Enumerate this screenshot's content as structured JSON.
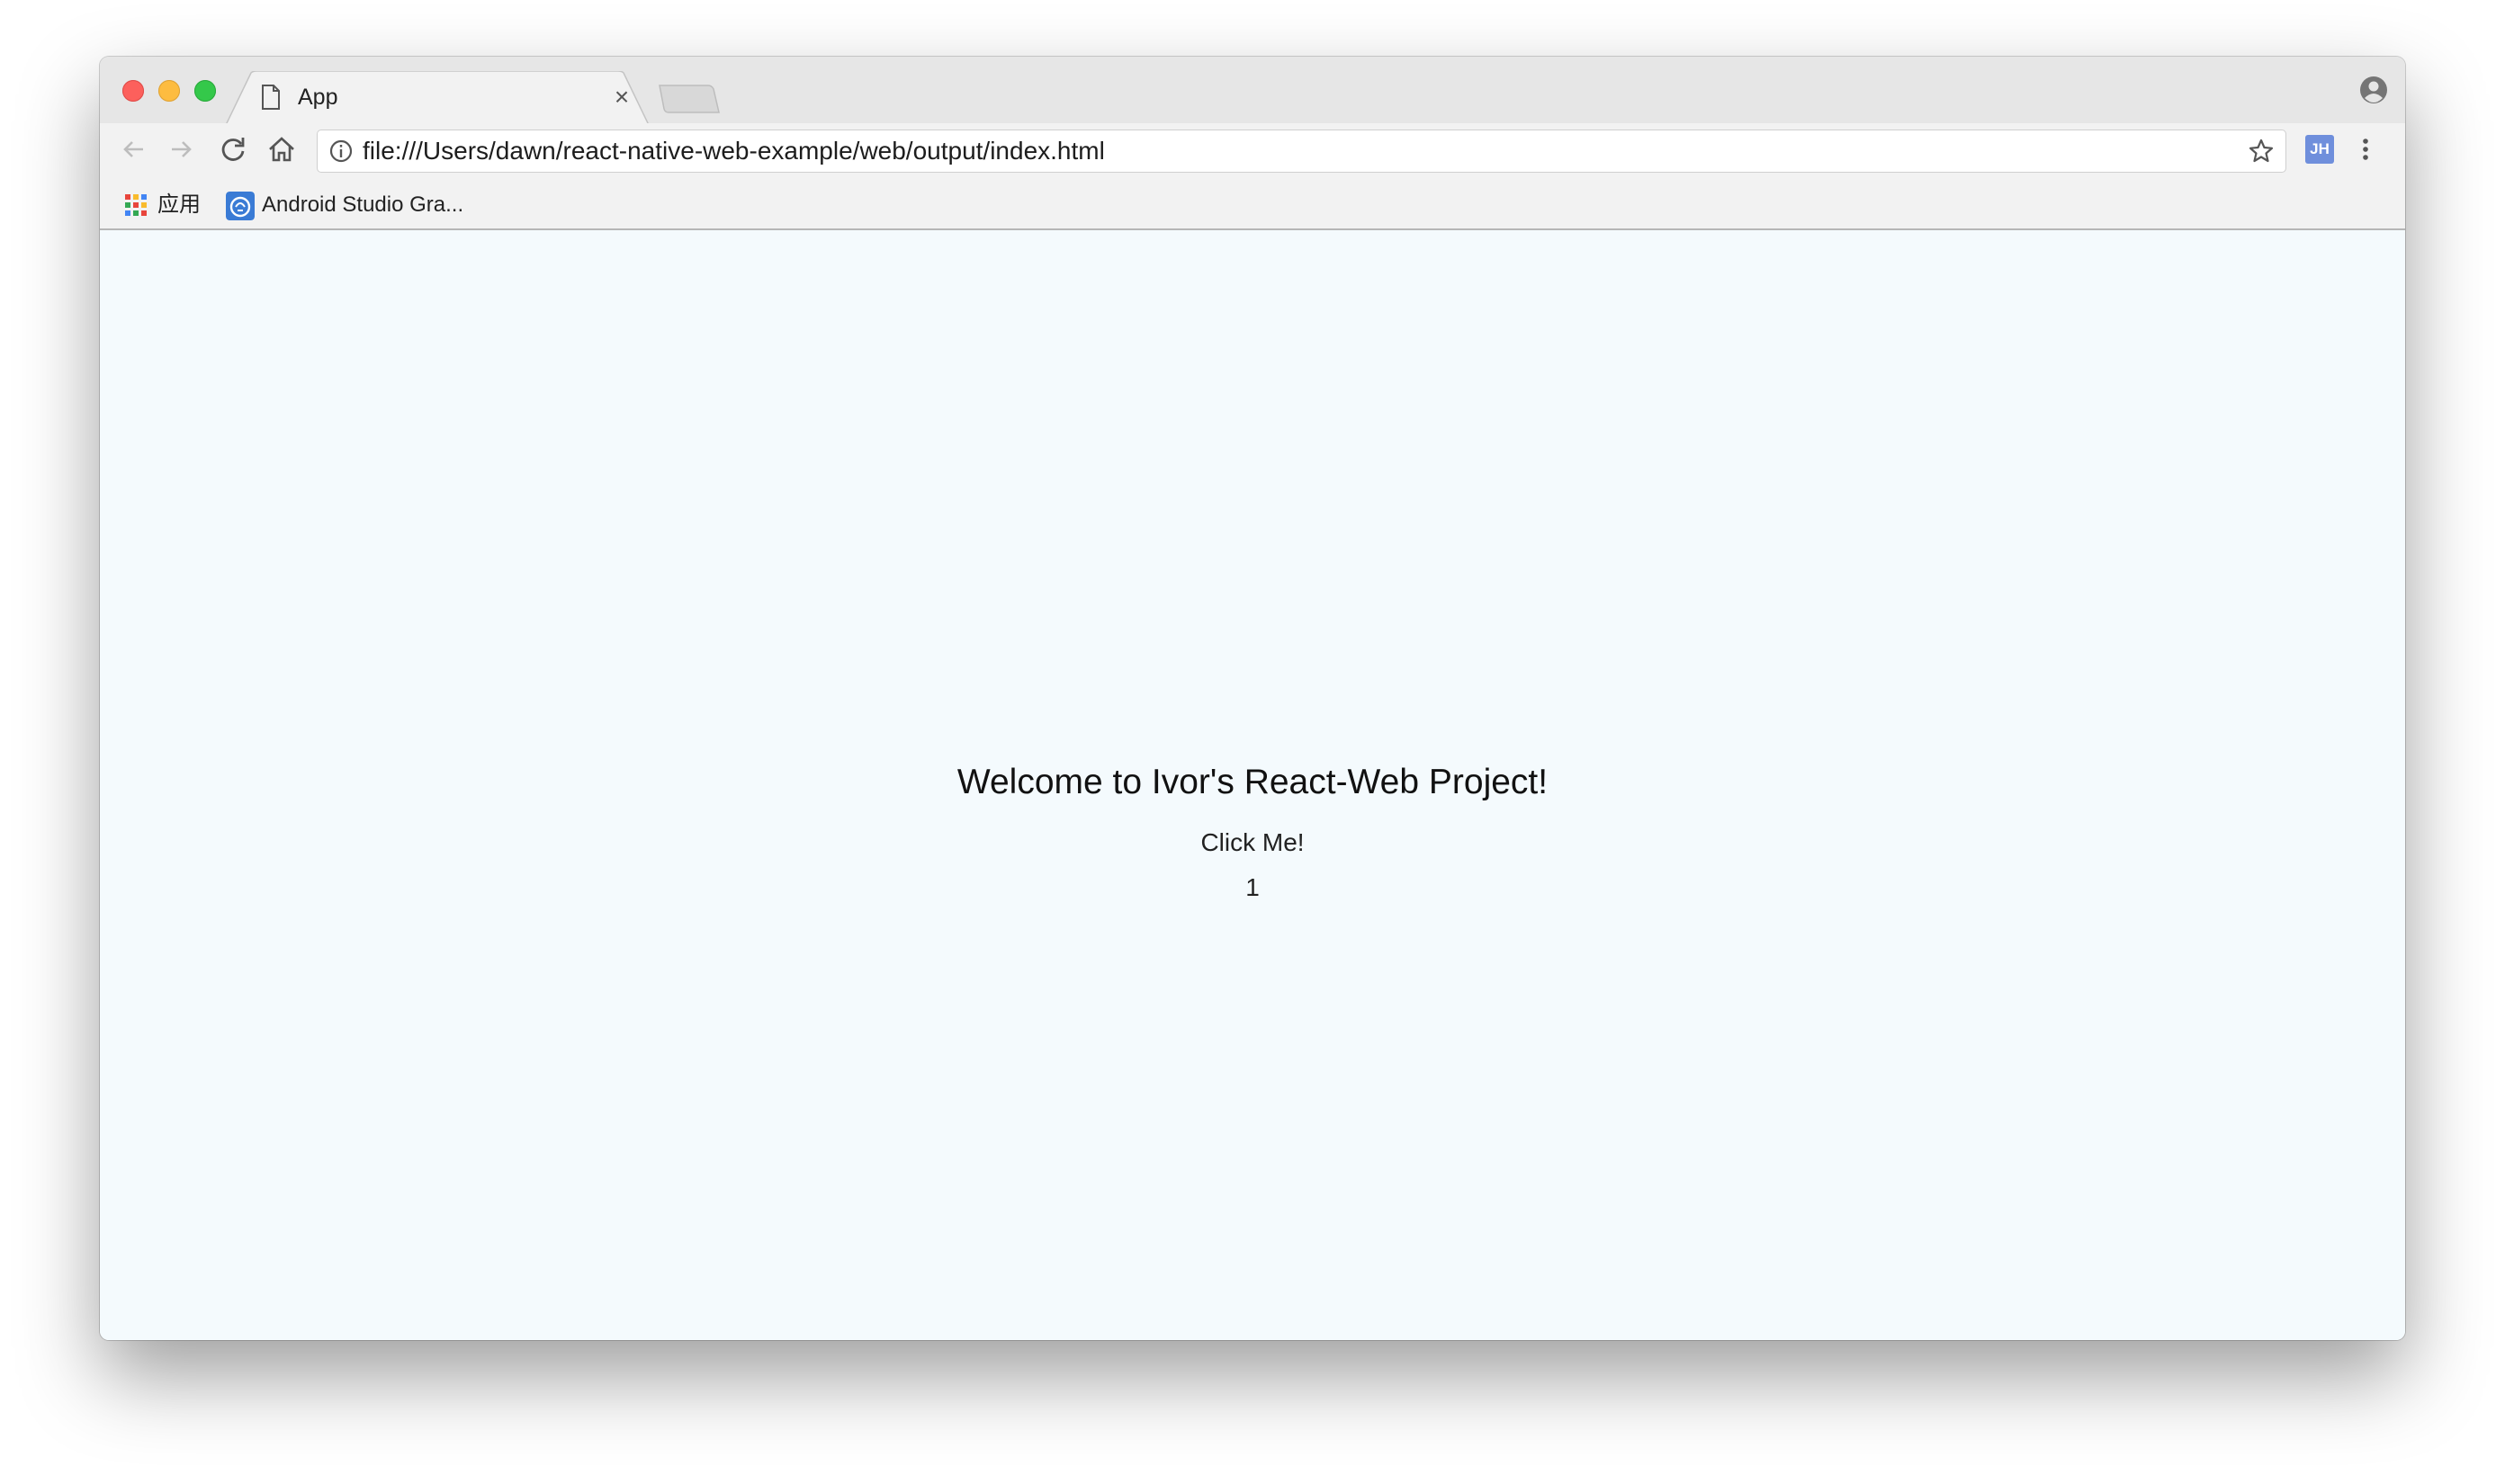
{
  "browser": {
    "tab": {
      "title": "App",
      "close_glyph": "×"
    },
    "omnibox": {
      "url": "file:///Users/dawn/react-native-web-example/web/output/index.html"
    },
    "extension": {
      "label": "JH"
    },
    "bookmarks": [
      {
        "label": "应用",
        "icon": "apps-grid-icon"
      },
      {
        "label": "Android Studio Gra...",
        "icon": "bookmark-favicon"
      }
    ]
  },
  "page": {
    "welcome": "Welcome to Ivor's React-Web Project!",
    "button_label": "Click Me!",
    "counter": "1"
  },
  "colors": {
    "content_bg": "#f4fafd",
    "close": "#fc605c",
    "minimize": "#fdbc40",
    "maximize": "#34c84a",
    "extension": "#6f8fdc"
  }
}
